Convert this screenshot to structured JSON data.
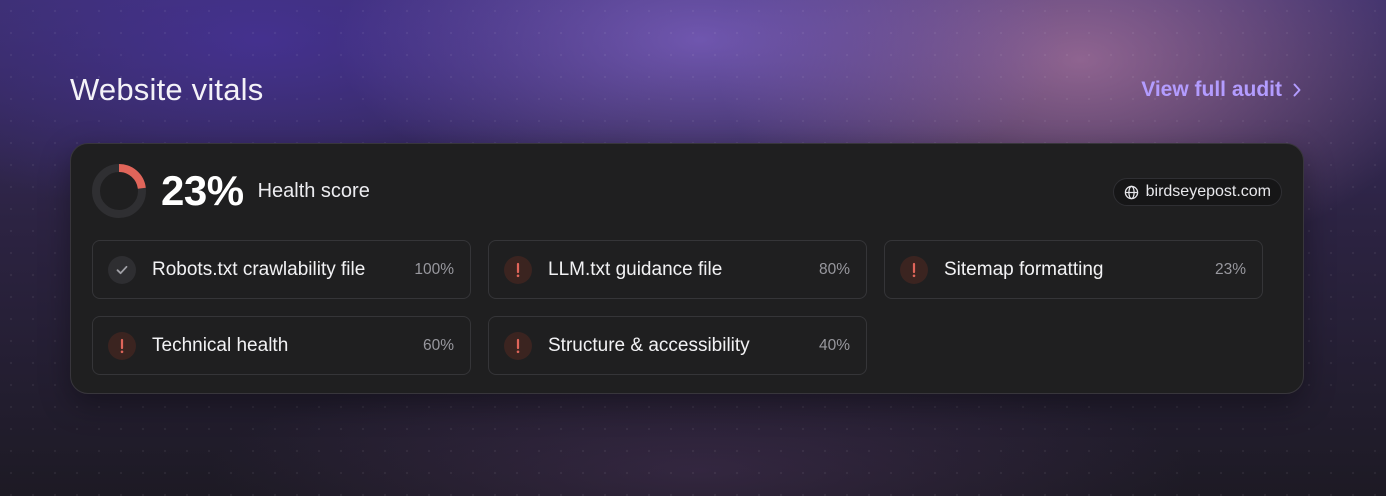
{
  "header": {
    "title": "Website vitals",
    "audit_link_label": "View full audit",
    "audit_link_icon": "chevron-right-icon"
  },
  "health": {
    "score_text": "23%",
    "score_fraction": 0.23,
    "label": "Health score",
    "ring_color": "#e0655a",
    "ring_track_color": "#2f2f32"
  },
  "site": {
    "domain": "birdseyepost.com",
    "icon": "globe-icon"
  },
  "vitals": [
    {
      "label": "Robots.txt crawlability file",
      "value": "100%",
      "status": "pass",
      "icon": "check-icon"
    },
    {
      "label": "LLM.txt guidance file",
      "value": "80%",
      "status": "warn",
      "icon": "exclamation-icon"
    },
    {
      "label": "Sitemap formatting",
      "value": "23%",
      "status": "warn",
      "icon": "exclamation-icon"
    },
    {
      "label": "Technical health",
      "value": "60%",
      "status": "warn",
      "icon": "exclamation-icon"
    },
    {
      "label": "Structure & accessibility",
      "value": "40%",
      "status": "warn",
      "icon": "exclamation-icon"
    }
  ],
  "colors": {
    "accent": "#b39cff",
    "warning": "#e0655a",
    "pass_icon": "#a0a0a6"
  }
}
